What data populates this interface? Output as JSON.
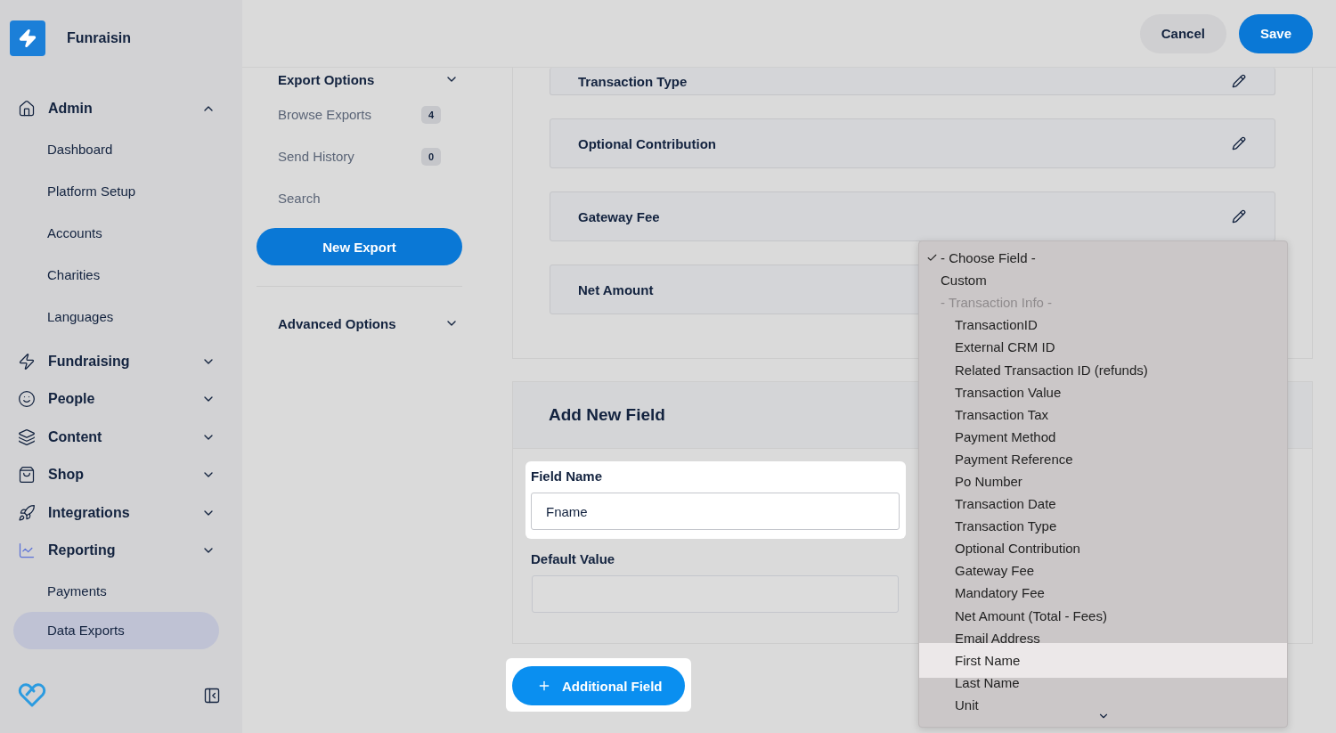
{
  "brand": {
    "name": "Funraisin"
  },
  "sidebar": {
    "sections": [
      {
        "label": "Admin",
        "expanded": true,
        "selected": false,
        "children": [
          {
            "label": "Dashboard",
            "selected": false
          },
          {
            "label": "Platform Setup",
            "selected": false
          },
          {
            "label": "Accounts",
            "selected": false
          },
          {
            "label": "Charities",
            "selected": false
          },
          {
            "label": "Languages",
            "selected": false
          }
        ]
      },
      {
        "label": "Fundraising",
        "expanded": false,
        "selected": false
      },
      {
        "label": "People",
        "expanded": false,
        "selected": false
      },
      {
        "label": "Content",
        "expanded": false,
        "selected": false
      },
      {
        "label": "Shop",
        "expanded": false,
        "selected": false
      },
      {
        "label": "Integrations",
        "expanded": false,
        "selected": false
      },
      {
        "label": "Reporting",
        "expanded": false,
        "selected": true,
        "children": [
          {
            "label": "Payments",
            "selected": false
          },
          {
            "label": "Data Exports",
            "selected": true
          }
        ]
      }
    ]
  },
  "header": {
    "buttons": [
      {
        "label": "Cancel",
        "kind": "secondary"
      },
      {
        "label": "Save",
        "kind": "primary"
      }
    ]
  },
  "subnav": {
    "title": "Export Options",
    "items": [
      {
        "label": "Browse Exports",
        "count": "4"
      },
      {
        "label": "Send History",
        "count": "0"
      },
      {
        "label": "Search"
      }
    ],
    "button": "New Export",
    "advanced": "Advanced Options"
  },
  "fields": [
    {
      "label": "Transaction Type",
      "cut": true
    },
    {
      "label": "Optional Contribution",
      "cut": false
    },
    {
      "label": "Gateway Fee",
      "cut": false
    },
    {
      "label": "Net Amount",
      "cut": false
    }
  ],
  "new_field": {
    "title": "Add New Field",
    "field_name": {
      "label": "Field Name",
      "value": "Fname"
    },
    "default_value": {
      "label": "Default Value"
    },
    "button": "Additional Field"
  },
  "dropdown": {
    "options": [
      {
        "label": "- Choose Field -",
        "kind": "option",
        "selected": true,
        "highlighted": false
      },
      {
        "label": "Custom",
        "kind": "option",
        "selected": false,
        "highlighted": false
      },
      {
        "label": "- Transaction Info -",
        "kind": "group",
        "children": [
          {
            "label": "TransactionID",
            "kind": "option",
            "selected": false,
            "highlighted": false
          },
          {
            "label": "External CRM ID",
            "kind": "option",
            "selected": false,
            "highlighted": false
          },
          {
            "label": "Related Transaction ID (refunds)",
            "kind": "option",
            "selected": false,
            "highlighted": false
          },
          {
            "label": "Transaction Value",
            "kind": "option",
            "selected": false,
            "highlighted": false
          },
          {
            "label": "Transaction Tax",
            "kind": "option",
            "selected": false,
            "highlighted": false
          },
          {
            "label": "Payment Method",
            "kind": "option",
            "selected": false,
            "highlighted": false
          },
          {
            "label": "Payment Reference",
            "kind": "option",
            "selected": false,
            "highlighted": false
          },
          {
            "label": "Po Number",
            "kind": "option",
            "selected": false,
            "highlighted": false
          },
          {
            "label": "Transaction Date",
            "kind": "option",
            "selected": false,
            "highlighted": false
          },
          {
            "label": "Transaction Type",
            "kind": "option",
            "selected": false,
            "highlighted": false
          },
          {
            "label": "Optional Contribution",
            "kind": "option",
            "selected": false,
            "highlighted": false
          },
          {
            "label": "Gateway Fee",
            "kind": "option",
            "selected": false,
            "highlighted": false
          },
          {
            "label": "Mandatory Fee",
            "kind": "option",
            "selected": false,
            "highlighted": false
          },
          {
            "label": "Net Amount (Total - Fees)",
            "kind": "option",
            "selected": false,
            "highlighted": false
          },
          {
            "label": "Email Address",
            "kind": "option",
            "selected": false,
            "highlighted": false
          },
          {
            "label": "First Name",
            "kind": "option",
            "selected": false,
            "highlighted": true
          },
          {
            "label": "Last Name",
            "kind": "option",
            "selected": false,
            "highlighted": false
          },
          {
            "label": "Unit",
            "kind": "option",
            "selected": false,
            "highlighted": false
          }
        ]
      }
    ]
  }
}
